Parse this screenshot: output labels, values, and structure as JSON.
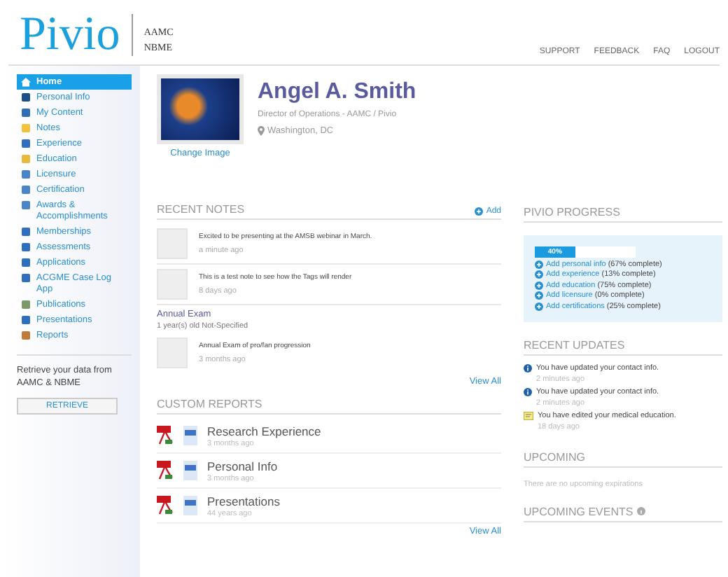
{
  "header": {
    "logo": "Pivio",
    "partner_logos": [
      "AAMC",
      "NBME"
    ],
    "links": [
      "SUPPORT",
      "FEEDBACK",
      "FAQ",
      "LOGOUT"
    ]
  },
  "sidebar": {
    "items": [
      {
        "label": "Home",
        "selected": true
      },
      {
        "label": "Personal Info",
        "selected": false
      },
      {
        "label": "My Content",
        "selected": false
      },
      {
        "label": "Notes",
        "selected": false
      },
      {
        "label": "Experience",
        "selected": false
      },
      {
        "label": "Education",
        "selected": false
      },
      {
        "label": "Licensure",
        "selected": false
      },
      {
        "label": "Certification",
        "selected": false
      },
      {
        "label": "Awards & Accomplishments",
        "selected": false
      },
      {
        "label": "Memberships",
        "selected": false
      },
      {
        "label": "Assessments",
        "selected": false
      },
      {
        "label": "Applications",
        "selected": false
      },
      {
        "label": "ACGME Case Log App",
        "selected": false
      },
      {
        "label": "Publications",
        "selected": false
      },
      {
        "label": "Presentations",
        "selected": false
      },
      {
        "label": "Reports",
        "selected": false
      }
    ],
    "retrieve_text": "Retrieve your data from AAMC & NBME",
    "retrieve_button": "RETRIEVE"
  },
  "profile": {
    "name": "Angel A. Smith",
    "title": "Director of Operations - AAMC / Pivio",
    "location": "Washington, DC",
    "change_image": "Change Image"
  },
  "recent_notes": {
    "title": "RECENT NOTES",
    "add": "Add",
    "notes": [
      {
        "text": "Excited to be presenting at the AMSB webinar in March.",
        "time": "a minute ago"
      },
      {
        "text": "This is a test note to see how the Tags will render",
        "time": "8 days ago"
      }
    ],
    "group": {
      "title": "Annual Exam",
      "subtitle": "1 year(s) old Not-Specified",
      "notes": [
        {
          "text": "Annual Exam of pro/fan progression",
          "time": "3 months ago"
        }
      ]
    },
    "view_all": "View All"
  },
  "custom_reports": {
    "title": "CUSTOM REPORTS",
    "reports": [
      {
        "name": "Research Experience",
        "time": "3 months ago"
      },
      {
        "name": "Personal Info",
        "time": "3 months ago"
      },
      {
        "name": "Presentations",
        "time": "44 years ago"
      }
    ],
    "view_all": "View All"
  },
  "progress": {
    "title": "PIVIO PROGRESS",
    "level": 0.4,
    "reading": "40%",
    "items": [
      {
        "link": "Add personal info",
        "note": "(67% complete)"
      },
      {
        "link": "Add experience",
        "note": "(13% complete)"
      },
      {
        "link": "Add education",
        "note": "(75% complete)"
      },
      {
        "link": "Add licensure",
        "note": "(0% complete)"
      },
      {
        "link": "Add certifications",
        "note": "(25% complete)"
      }
    ]
  },
  "recent_updates": {
    "title": "RECENT UPDATES",
    "items": [
      {
        "kind": "info",
        "text": "You have updated your contact info.",
        "time": "2 minutes ago"
      },
      {
        "kind": "info",
        "text": "You have updated your contact info.",
        "time": "2 minutes ago"
      },
      {
        "kind": "education",
        "text": "You have edited your medical education.",
        "time": "18 days ago"
      }
    ]
  },
  "upcoming": {
    "title": "UPCOMING",
    "text": "There are no upcoming expirations"
  },
  "upcoming_events": {
    "title": "UPCOMING EVENTS"
  }
}
